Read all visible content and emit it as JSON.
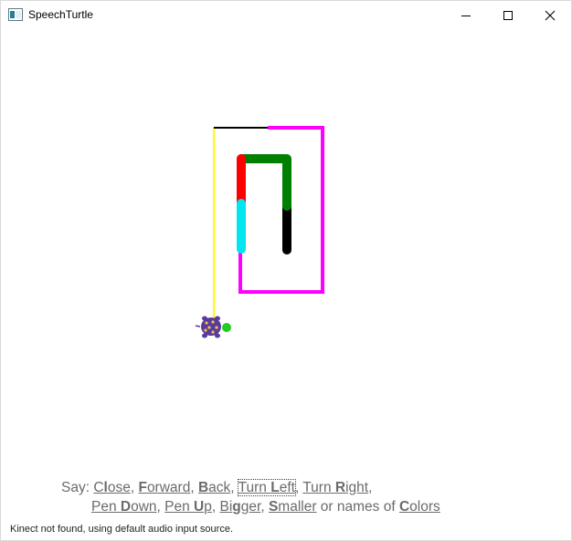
{
  "window": {
    "title": "SpeechTurtle"
  },
  "titlebar": {
    "minimize_icon": "minimize-icon",
    "maximize_icon": "maximize-icon",
    "close_icon": "close-icon"
  },
  "drawing": {
    "pen_colors": [
      "#000000",
      "#ff00ff",
      "#ffff00",
      "#ff0000",
      "#008000",
      "#00e5ee"
    ],
    "turtle": {
      "shell_color": "#5b3a9e",
      "head_color": "#22cc22",
      "icon": "turtle-icon"
    }
  },
  "commands": {
    "say_label": "Say:",
    "close": {
      "pre": "C",
      "hot": "l",
      "post": "ose"
    },
    "forward": {
      "pre": "",
      "hot": "F",
      "post": "orward"
    },
    "back": {
      "pre": "",
      "hot": "B",
      "post": "ack"
    },
    "turn_left": {
      "pre": "Turn ",
      "hot": "L",
      "post": "eft"
    },
    "turn_right": {
      "pre": "Turn ",
      "hot": "R",
      "post": "ight"
    },
    "pen_down": {
      "pre": "Pen ",
      "hot": "D",
      "post": "own"
    },
    "pen_up": {
      "pre": "Pen ",
      "hot": "U",
      "post": "p"
    },
    "bigger": {
      "pre": "Bi",
      "hot": "g",
      "post": "ger"
    },
    "smaller": {
      "pre": "",
      "hot": "S",
      "post": "maller"
    },
    "colors": {
      "pre": "",
      "hot": "C",
      "post": "olors"
    },
    "or_names_of": " or names of ",
    "comma": ",",
    "comma_space": ", "
  },
  "status": {
    "message": "Kinect not found, using default audio input source."
  }
}
